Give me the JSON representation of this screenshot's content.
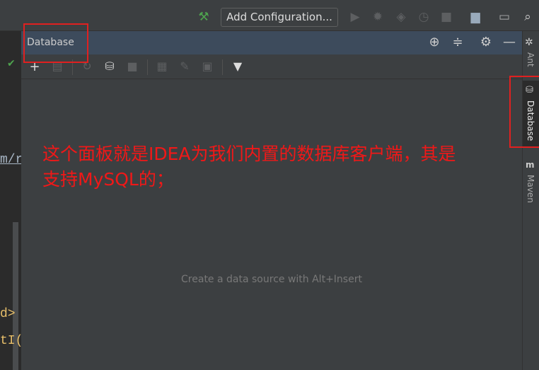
{
  "toolbar": {
    "add_configuration": "Add Configuration..."
  },
  "panel": {
    "title": "Database",
    "empty_hint": "Create a data source with Alt+Insert"
  },
  "right_sidebar": {
    "items": [
      "Ant",
      "Database",
      "Maven"
    ]
  },
  "editor": {
    "fragments": [
      "m/r",
      "d>",
      "tI("
    ]
  },
  "annotation": {
    "line1": "这个面板就是IDEA为我们内置的数据库客户端，其是",
    "line2": "支持MySQL的；"
  },
  "colors": {
    "accent": "#3d4b5c",
    "annotation": "#f01818"
  }
}
